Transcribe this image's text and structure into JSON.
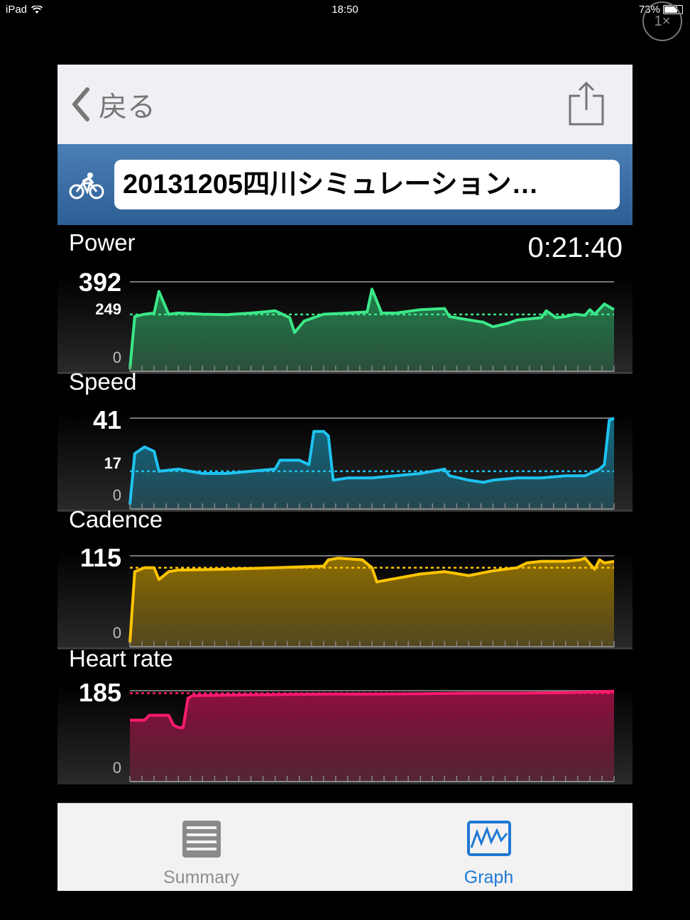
{
  "status_bar": {
    "carrier": "iPad",
    "time": "18:50",
    "battery": "73%",
    "battery_level": 0.73
  },
  "zoom_badge": "1×",
  "nav": {
    "back_label": "戻る",
    "share_icon": "share-icon",
    "back_icon": "chevron-left-icon"
  },
  "activity": {
    "title": "20131205四川シミュレーション…",
    "type_icon": "cycling-icon"
  },
  "elapsed_time": "0:21:40",
  "colors": {
    "power": "#3be889",
    "speed": "#1ec3f0",
    "cadence": "#ffc400",
    "heart_rate": "#ff1a6e",
    "tab_active": "#1f78d4"
  },
  "panels": [
    {
      "name": "Power",
      "max_label": "392",
      "avg_label": "249",
      "min_label": "0",
      "max": 392,
      "avg": 249
    },
    {
      "name": "Speed",
      "max_label": "41",
      "avg_label": "17",
      "min_label": "0",
      "max": 41,
      "avg": 17
    },
    {
      "name": "Cadence",
      "max_label": "115",
      "avg_label": "",
      "min_label": "0",
      "max": 115,
      "avg": 100
    },
    {
      "name": "Heart rate",
      "max_label": "185",
      "avg_label": "",
      "min_label": "0",
      "max": 185,
      "avg": 180
    }
  ],
  "tabs": [
    {
      "label": "Summary",
      "icon": "summary-icon",
      "active": false
    },
    {
      "label": "Graph",
      "icon": "graph-icon",
      "active": true
    }
  ],
  "chart_data": [
    {
      "type": "area",
      "title": "Power",
      "ylim": [
        0,
        392
      ],
      "average": 249,
      "x": [
        0,
        0.01,
        0.03,
        0.05,
        0.06,
        0.08,
        0.1,
        0.15,
        0.2,
        0.25,
        0.3,
        0.33,
        0.34,
        0.36,
        0.4,
        0.45,
        0.49,
        0.5,
        0.52,
        0.55,
        0.6,
        0.65,
        0.66,
        0.7,
        0.73,
        0.75,
        0.78,
        0.8,
        0.85,
        0.86,
        0.88,
        0.9,
        0.92,
        0.94,
        0.95,
        0.96,
        0.98,
        1
      ],
      "values": [
        10,
        240,
        250,
        255,
        350,
        250,
        255,
        250,
        248,
        255,
        265,
        235,
        170,
        220,
        250,
        255,
        260,
        360,
        255,
        255,
        270,
        275,
        240,
        225,
        215,
        195,
        210,
        225,
        235,
        265,
        235,
        240,
        250,
        245,
        270,
        250,
        295,
        270
      ]
    },
    {
      "type": "area",
      "title": "Speed",
      "ylim": [
        0,
        41
      ],
      "average": 17,
      "x": [
        0,
        0.01,
        0.03,
        0.05,
        0.06,
        0.1,
        0.15,
        0.2,
        0.25,
        0.3,
        0.31,
        0.35,
        0.37,
        0.38,
        0.4,
        0.41,
        0.42,
        0.45,
        0.5,
        0.6,
        0.65,
        0.66,
        0.7,
        0.73,
        0.75,
        0.8,
        0.85,
        0.9,
        0.94,
        0.97,
        0.98,
        0.99,
        1
      ],
      "values": [
        2,
        25,
        28,
        26,
        17,
        18,
        16,
        16,
        17,
        18,
        22,
        22,
        20,
        35,
        35,
        33,
        13,
        14,
        14,
        16,
        18,
        15,
        13,
        12,
        13,
        14,
        14,
        15,
        15,
        18,
        20,
        40,
        41
      ]
    },
    {
      "type": "area",
      "title": "Cadence",
      "ylim": [
        0,
        115
      ],
      "average": 100,
      "x": [
        0,
        0.01,
        0.03,
        0.05,
        0.06,
        0.08,
        0.1,
        0.2,
        0.3,
        0.4,
        0.41,
        0.43,
        0.48,
        0.5,
        0.51,
        0.6,
        0.65,
        0.7,
        0.75,
        0.8,
        0.82,
        0.85,
        0.9,
        0.93,
        0.94,
        0.96,
        0.97,
        0.98,
        1
      ],
      "values": [
        5,
        95,
        100,
        100,
        85,
        95,
        97,
        98,
        100,
        102,
        110,
        112,
        110,
        100,
        82,
        92,
        95,
        90,
        96,
        100,
        106,
        108,
        108,
        110,
        112,
        98,
        110,
        106,
        108
      ]
    },
    {
      "type": "area",
      "title": "Heart rate",
      "ylim": [
        0,
        185
      ],
      "average": 180,
      "x": [
        0,
        0.03,
        0.04,
        0.08,
        0.09,
        0.1,
        0.11,
        0.12,
        0.13,
        0.2,
        0.3,
        0.4,
        0.5,
        0.6,
        0.7,
        0.8,
        0.9,
        1
      ],
      "values": [
        125,
        125,
        135,
        135,
        115,
        110,
        110,
        170,
        175,
        176,
        177,
        178,
        178,
        179,
        180,
        180,
        181,
        184
      ]
    }
  ]
}
